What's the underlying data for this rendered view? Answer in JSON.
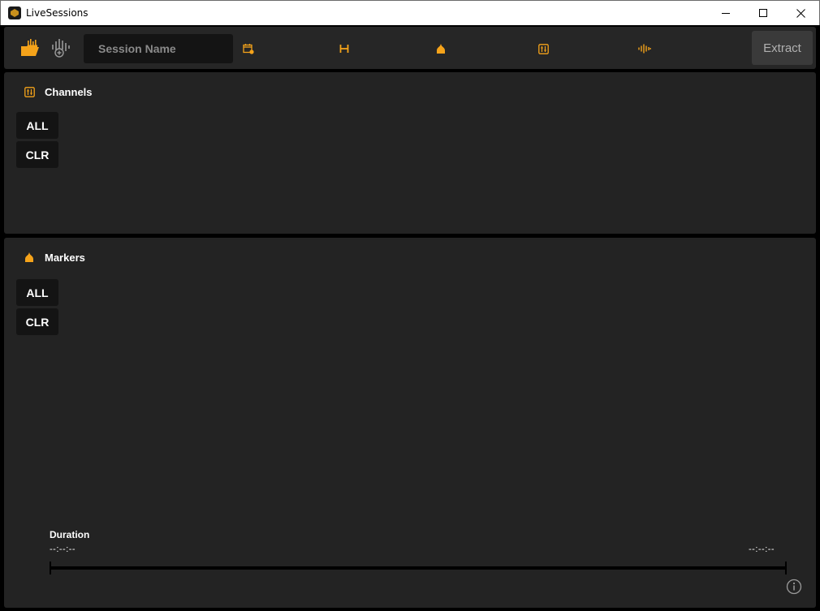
{
  "window": {
    "title": "LiveSessions",
    "controls": [
      "minimize-icon",
      "maximize-icon",
      "close-icon"
    ]
  },
  "toolbar": {
    "session_placeholder": "Session Name",
    "session_value": "",
    "extract_label": "Extract",
    "icons": [
      "open-folder-icon",
      "add-audio-icon",
      "calendar-icon",
      "range-icon",
      "marker-icon",
      "channels-icon",
      "waveform-icon"
    ]
  },
  "channels": {
    "title": "Channels",
    "all_label": "ALL",
    "clear_label": "CLR"
  },
  "markers": {
    "title": "Markers",
    "all_label": "ALL",
    "clear_label": "CLR"
  },
  "duration": {
    "label": "Duration",
    "start": "--:--:--",
    "end": "--:--:--"
  },
  "colors": {
    "accent": "#f5a31a",
    "background": "#000000",
    "panel": "#232323",
    "toolbar": "#262626",
    "button": "#141414"
  }
}
